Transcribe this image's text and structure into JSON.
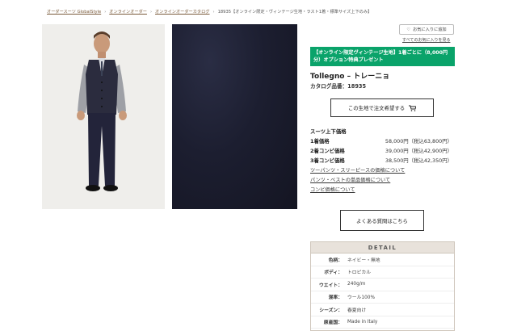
{
  "breadcrumb": {
    "items": [
      "オーダースーツ GlobalStyle",
      "オンラインオーダー",
      "オンラインオーダーカタログ"
    ],
    "current": "18935【オンライン限定・ヴィンテージ生地・ラスト1着・標準サイズ上下のみ】",
    "separator": "›"
  },
  "favorite": {
    "add_label": "お気に入りに追加",
    "list_link": "すべてのお気に入りを見る"
  },
  "promo": {
    "text": "【オンライン限定ヴィンテージ生地】1着ごとに（8,000円分）オプション特典プレゼント"
  },
  "product": {
    "name": "Tollegno – トレーニョ",
    "catalog_no": "カタログ品番：18935"
  },
  "order_button": {
    "label": "この生地で注文希望する"
  },
  "prices": {
    "heading": "スーツ上下価格",
    "rows": [
      {
        "label": "1着価格",
        "value": "58,000円（税込63,800円）"
      },
      {
        "label": "2着コンビ価格",
        "value": "39,000円（税込42,900円）"
      },
      {
        "label": "3着コンビ価格",
        "value": "38,500円（税込42,350円）"
      }
    ]
  },
  "links": [
    "ツーパンツ・スリーピースの価格について",
    "パンツ・ベストの単品価格について",
    "コンビ価格について"
  ],
  "faq_button": {
    "label": "よくある質問はこちら"
  },
  "detail": {
    "header": "DETAIL",
    "rows": [
      {
        "label": "色柄：",
        "value": "ネイビー・無地"
      },
      {
        "label": "ボディ：",
        "value": "トロピカル"
      },
      {
        "label": "ウエイト：",
        "value": "240g/m"
      },
      {
        "label": "混率：",
        "value": "ウール100%"
      },
      {
        "label": "シーズン：",
        "value": "春夏向け"
      },
      {
        "label": "原産国：",
        "value": "Made in Italy"
      }
    ]
  },
  "colors": {
    "promo_bg": "#0aa36a",
    "fabric": "#1c1e30",
    "detail_header_bg": "#e8e2db"
  }
}
